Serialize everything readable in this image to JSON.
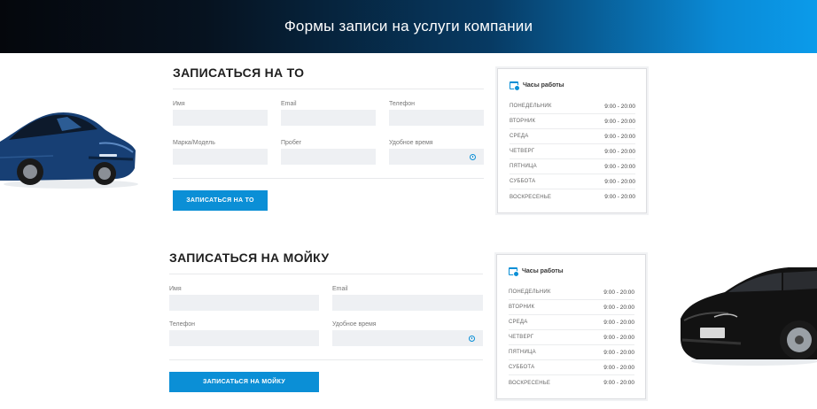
{
  "banner": {
    "title": "Формы записи на услуги компании"
  },
  "to_form": {
    "title": "ЗАПИСАТЬСЯ НА ТО",
    "fields": [
      {
        "label": "Имя",
        "value": ""
      },
      {
        "label": "Email",
        "value": ""
      },
      {
        "label": "Телефон",
        "value": ""
      },
      {
        "label": "Марка/Модель",
        "value": ""
      },
      {
        "label": "Пробег",
        "value": ""
      },
      {
        "label": "Удобное время",
        "value": ""
      }
    ],
    "submit_label": "ЗАПИСАТЬСЯ НА ТО"
  },
  "wash_form": {
    "title": "ЗАПИСАТЬСЯ НА МОЙКУ",
    "fields": [
      {
        "label": "Имя",
        "value": ""
      },
      {
        "label": "Email",
        "value": ""
      },
      {
        "label": "Телефон",
        "value": ""
      },
      {
        "label": "Удобное время",
        "value": ""
      }
    ],
    "submit_label": "ЗАПИСАТЬСЯ НА МОЙКУ"
  },
  "hours": {
    "title": "Часы работы",
    "rows": [
      {
        "day": "Понедельник",
        "time": "9:00 - 20:00"
      },
      {
        "day": "Вторник",
        "time": "9:00 - 20:00"
      },
      {
        "day": "Среда",
        "time": "9:00 - 20:00"
      },
      {
        "day": "Четверг",
        "time": "9:00 - 20:00"
      },
      {
        "day": "Пятница",
        "time": "9:00 - 20:00"
      },
      {
        "day": "Суббота",
        "time": "9:00 - 20:00"
      },
      {
        "day": "Воскресенье",
        "time": "9:00 - 20:00"
      }
    ]
  },
  "icons": {
    "clock": "clock-icon",
    "calendar": "calendar-icon"
  },
  "colors": {
    "accent": "#0b8fd6",
    "field_bg": "#eef0f3",
    "blue_car": "#123a6b",
    "black_car": "#111111"
  }
}
